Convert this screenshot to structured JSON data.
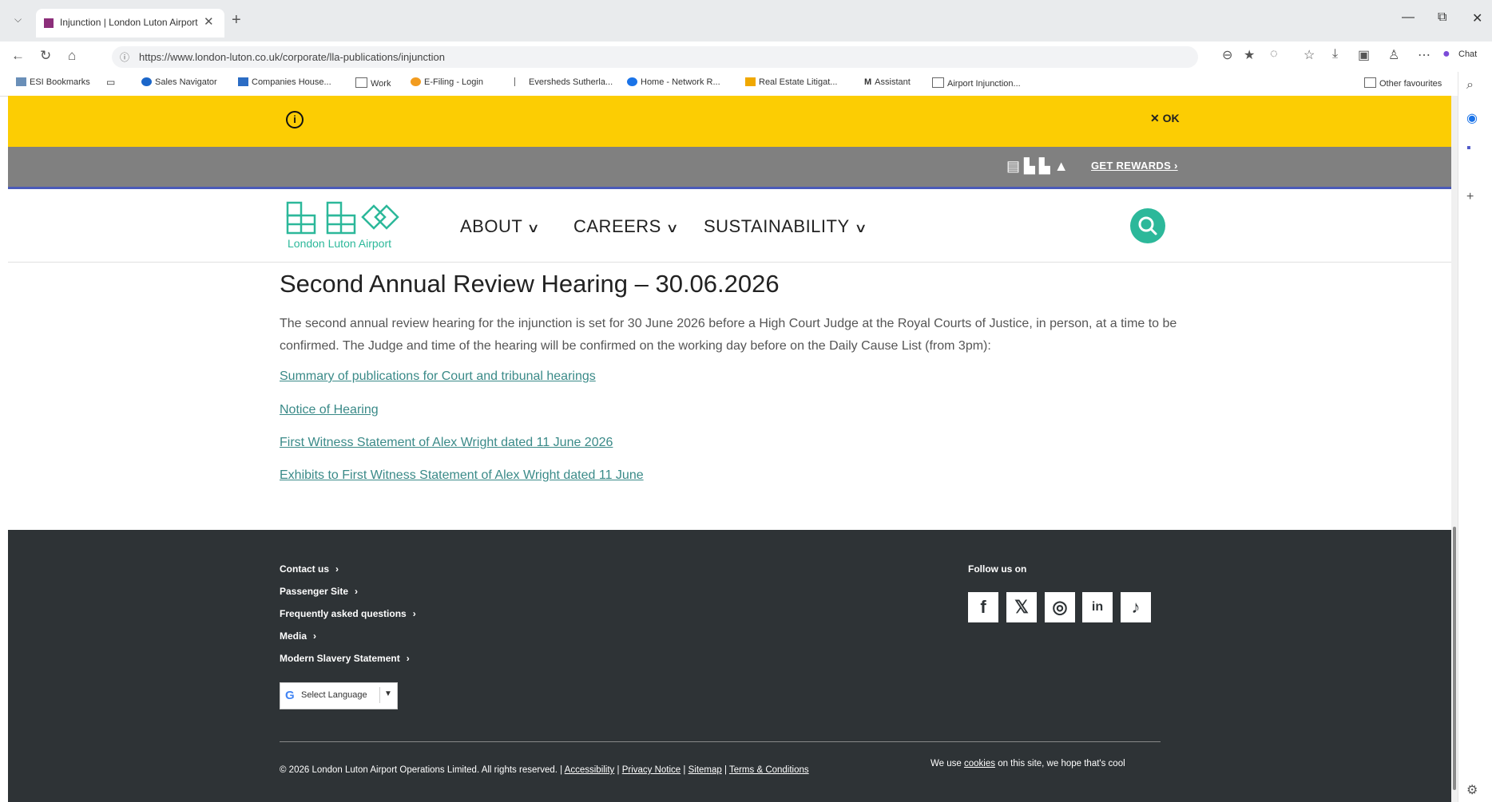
{
  "browser": {
    "tab_title": "Injunction | London Luton Airport",
    "tab_close": "✕",
    "new_tab": "+",
    "url": "https://www.london-luton.co.uk/corporate/lla-publications/injunction",
    "bookmarks": [
      "ESI Bookmarks",
      "Sales Navigator",
      "Companies House...",
      "Work",
      "E-Filing - Login",
      "Eversheds Sutherla...",
      "Home - Network R...",
      "Real Estate Litigat...",
      "Assistant",
      "Airport Injunction..."
    ],
    "other_favourites": "Other favourites",
    "copilot_label": "Chat",
    "colors": {
      "tab_favicon": "#8c2e7a",
      "accent": "#2cb89a"
    }
  },
  "notice": {
    "ok_label": "✕  OK",
    "color": "#fccd03"
  },
  "rewards": {
    "link_label": "GET REWARDS ›"
  },
  "header": {
    "logo_text": "London Luton Airport",
    "menu": [
      {
        "label": "ABOUT"
      },
      {
        "label": "CAREERS"
      },
      {
        "label": "SUSTAINABILITY"
      }
    ]
  },
  "content": {
    "heading": "Second Annual Review Hearing – 30.06.2026",
    "paragraph": "The second annual review hearing for the injunction is set for 30 June 2026 before a High Court Judge at the Royal Courts of Justice, in person, at a time to be confirmed. The Judge and time of the hearing will be confirmed on the working day before on the Daily Cause List (from 3pm):",
    "links": [
      "Summary of publications for Court and tribunal hearings",
      "Notice of Hearing",
      "First Witness Statement of Alex Wright dated 11 June 2026",
      "Exhibits to First Witness Statement of Alex Wright dated 11 June"
    ]
  },
  "footer": {
    "links": [
      "Contact us",
      "Passenger Site",
      "Frequently asked questions",
      "Media",
      "Modern Slavery Statement"
    ],
    "follow_label": "Follow us on",
    "social": [
      "facebook",
      "x",
      "instagram",
      "linkedin",
      "tiktok"
    ],
    "language_label": "Select Language",
    "copyright": "© 2026 London Luton Airport Operations Limited. All rights reserved. |",
    "legal_links": [
      "Accessibility",
      "Privacy Notice",
      "Sitemap",
      "Terms & Conditions"
    ],
    "cookie_prefix": "We use",
    "cookie_link": "cookies",
    "cookie_suffix": "on this site, we hope that's cool",
    "background": "#2e3336"
  }
}
